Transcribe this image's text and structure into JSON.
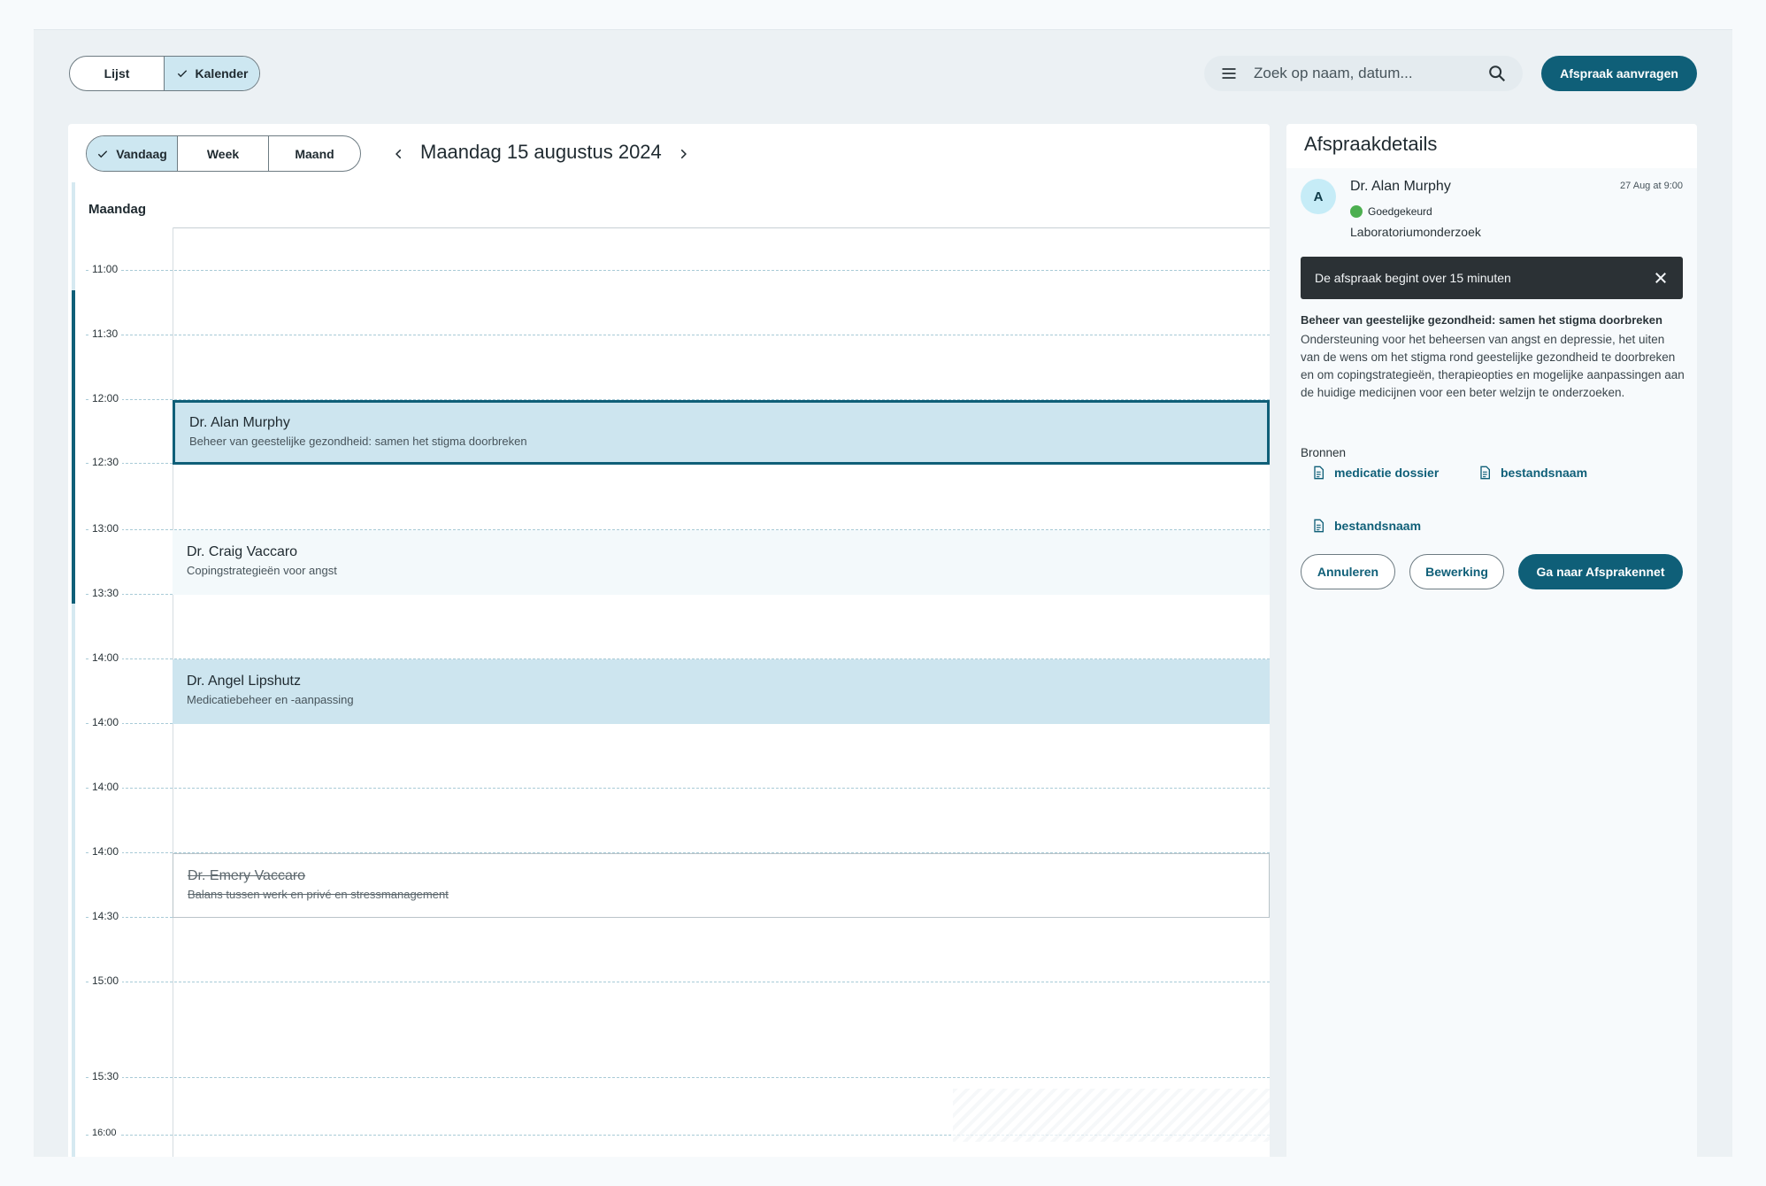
{
  "top_bar": {
    "view_toggle": {
      "list_label": "Lijst",
      "calendar_label": "Kalender",
      "selected": "Kalender"
    },
    "search": {
      "placeholder": "Zoek op naam, datum..."
    },
    "request_button": "Afspraak aanvragen"
  },
  "calendar": {
    "range_toggle": {
      "today": "Vandaag",
      "week": "Week",
      "month": "Maand",
      "selected": "Vandaag"
    },
    "date_title": "Maandag 15 augustus 2024",
    "day_header": "Maandag",
    "time_slots": [
      "11:00",
      "11:30",
      "12:00",
      "12:30",
      "13:00",
      "13:30",
      "14:00",
      "14:00",
      "14:00",
      "14:00",
      "14:30",
      "15:00",
      "15:30",
      "16:00"
    ],
    "events": [
      {
        "doctor": "Dr. Alan Murphy",
        "topic": "Beheer van geestelijke gezondheid: samen het stigma doorbreken",
        "state": "selected"
      },
      {
        "doctor": "Dr. Craig Vaccaro",
        "topic": "Copingstrategieën voor angst",
        "state": "normal"
      },
      {
        "doctor": "Dr. Angel Lipshutz",
        "topic": "Medicatiebeheer en -aanpassing",
        "state": "highlighted"
      },
      {
        "doctor": "Dr. Emery Vaccaro",
        "topic": "Balans tussen werk en privé en stressmanagement",
        "state": "cancelled"
      }
    ]
  },
  "details": {
    "header": "Afspraakdetails",
    "avatar_initial": "A",
    "doctor": "Dr. Alan Murphy",
    "date_stamp": "27 Aug at 9:00",
    "status": "Goedgekeurd",
    "appointment_type": "Laboratoriumonderzoek",
    "toast": "De afspraak begint over 15 minuten",
    "description_title": "Beheer van geestelijke gezondheid: samen het stigma doorbreken",
    "description": "Ondersteuning voor het beheersen van angst en depressie, het uiten van de wens om het stigma rond geestelijke gezondheid te doorbreken en om copingstrategieën, therapieopties en mogelijke aanpassingen aan de huidige medicijnen voor een beter welzijn te onderzoeken.",
    "resources_title": "Bronnen",
    "resources": [
      "medicatie dossier",
      "bestandsnaam",
      "bestandsnaam"
    ],
    "buttons": {
      "cancel": "Annuleren",
      "edit": "Bewerking",
      "go": "Ga naar Afsprakennet"
    }
  },
  "colors": {
    "primary": "#0f5f78",
    "selected_bg": "#cde7f1",
    "status_green": "#4caf50",
    "toast_bg": "#2b3135"
  }
}
